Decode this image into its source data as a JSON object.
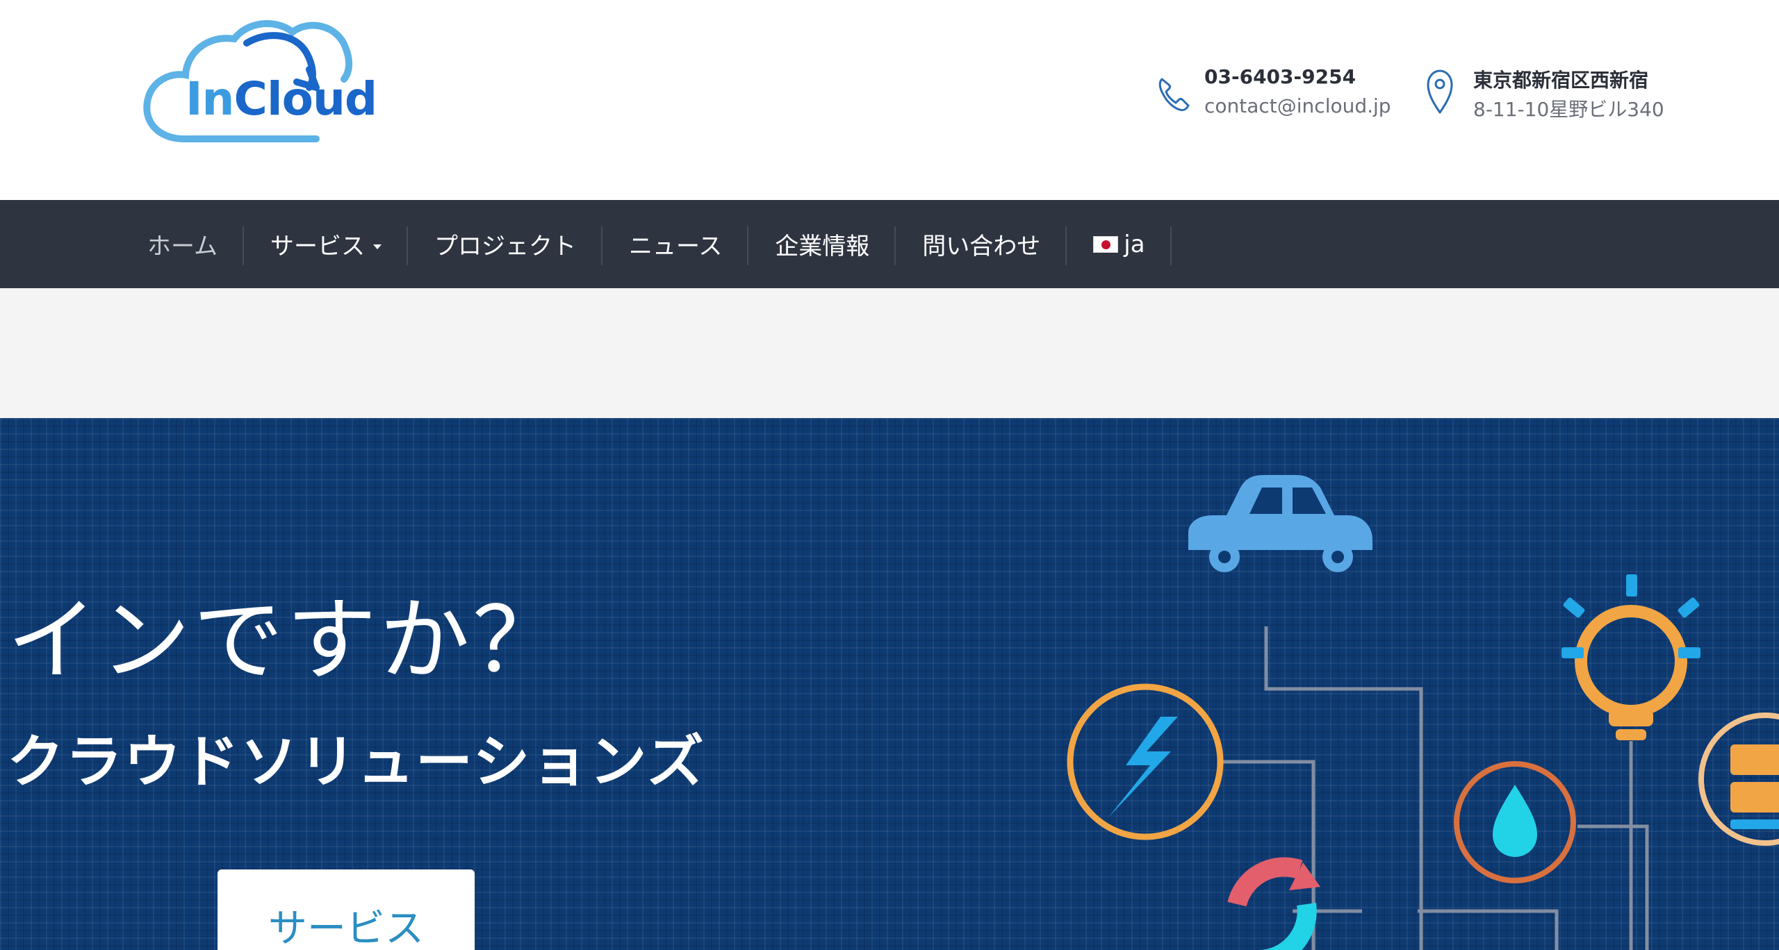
{
  "brand": {
    "logo_prefix": "In",
    "logo_suffix": "Cloud",
    "colors": {
      "accent_light": "#3d9be0",
      "accent_dark": "#1a67c9"
    }
  },
  "contact": {
    "phone": {
      "icon": "phone-icon",
      "number": "03-6403-9254",
      "email": "contact@incloud.jp"
    },
    "address": {
      "icon": "map-pin-icon",
      "line1": "東京都新宿区西新宿",
      "line2": "8-11-10星野ビル340"
    }
  },
  "nav": {
    "items": [
      {
        "label": "ホーム",
        "active": true
      },
      {
        "label": "サービス",
        "dropdown": true
      },
      {
        "label": "プロジェクト"
      },
      {
        "label": "ニュース"
      },
      {
        "label": "企業情報"
      },
      {
        "label": "問い合わせ"
      },
      {
        "label": "ja",
        "flag": "japan-flag-icon"
      }
    ]
  },
  "hero": {
    "title": "インですか？",
    "subtitle": "クラウドソリューションズ",
    "button_label": "サービス",
    "background_color": "#0e3a72",
    "illustration_icons": [
      "car-icon",
      "lightbulb-icon",
      "lightning-icon",
      "water-drop-icon",
      "refresh-icon",
      "server-icon"
    ]
  }
}
